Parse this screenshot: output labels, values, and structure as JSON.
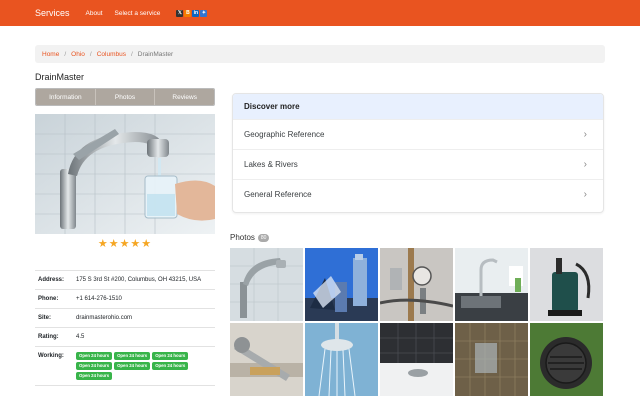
{
  "nav": {
    "brand": "Services",
    "links": [
      "About",
      "Select a service"
    ],
    "social_icons": [
      "x-icon",
      "blogger-icon",
      "linkedin-icon",
      "delicious-icon"
    ]
  },
  "breadcrumb": {
    "items": [
      "Home",
      "Ohio",
      "Columbus"
    ],
    "current": "DrainMaster"
  },
  "business": {
    "name": "DrainMaster",
    "tabs": [
      "Information",
      "Photos",
      "Reviews"
    ],
    "stars": "★★★★★",
    "info": {
      "address_label": "Address:",
      "address": "175 S 3rd St #200, Columbus, OH 43215, USA",
      "phone_label": "Phone:",
      "phone": "+1 614-276-1510",
      "site_label": "Site:",
      "site": "drainmasterohio.com",
      "rating_label": "Rating:",
      "rating": "4.5",
      "working_label": "Working:",
      "hours": [
        "Open 24 hours",
        "Open 24 hours",
        "Open 24 hours",
        "Open 24 hours",
        "Open 24 hours",
        "Open 24 hours",
        "Open 24 hours"
      ]
    }
  },
  "discover": {
    "title": "Discover more",
    "items": [
      "Geographic Reference",
      "Lakes & Rivers",
      "General Reference"
    ]
  },
  "photos": {
    "label": "Photos",
    "count": "80"
  },
  "colors": {
    "brand": "#e95420",
    "tab": "#aea79f",
    "badge": "#38b44a",
    "star": "#f5a623"
  }
}
